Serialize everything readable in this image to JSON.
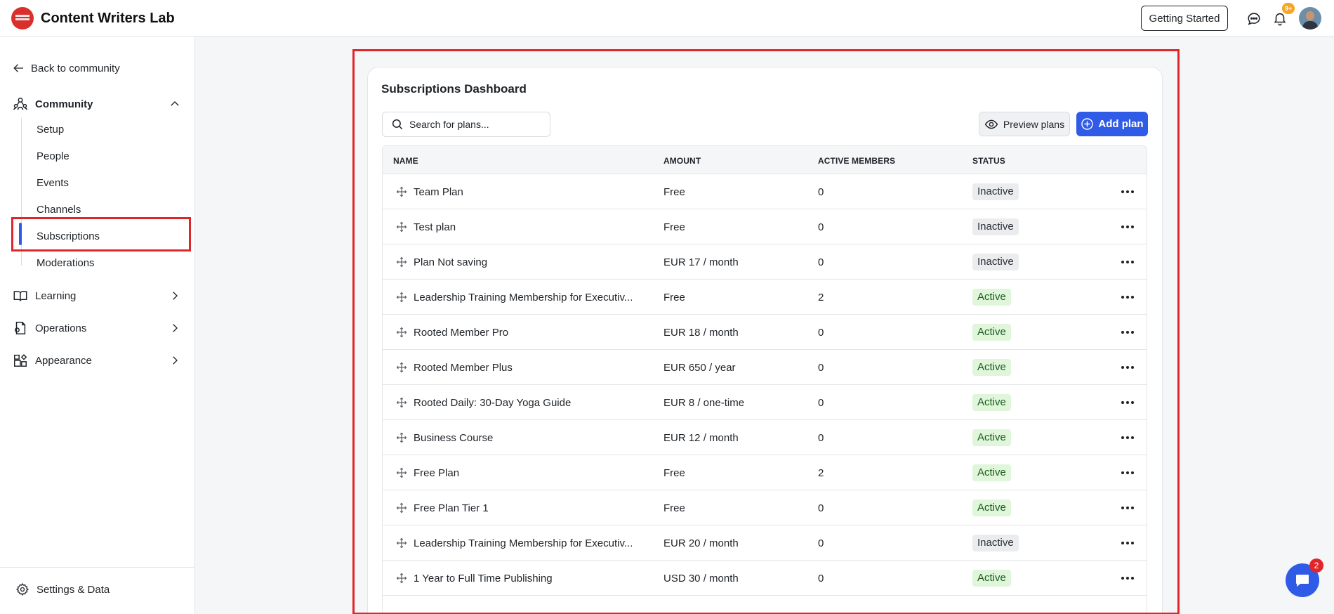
{
  "header": {
    "brand": "Content Writers Lab",
    "getting_started": "Getting Started",
    "notifications_count": "9+"
  },
  "sidebar": {
    "back_label": "Back to community",
    "community_label": "Community",
    "community_items": [
      "Setup",
      "People",
      "Events",
      "Channels",
      "Subscriptions",
      "Moderations"
    ],
    "active_item": "Subscriptions",
    "learning_label": "Learning",
    "operations_label": "Operations",
    "appearance_label": "Appearance",
    "settings_label": "Settings & Data"
  },
  "dashboard": {
    "title": "Subscriptions Dashboard",
    "search_placeholder": "Search for plans...",
    "preview_label": "Preview plans",
    "add_label": "Add plan",
    "columns": [
      "NAME",
      "AMOUNT",
      "ACTIVE MEMBERS",
      "STATUS"
    ],
    "rows": [
      {
        "name": "Team Plan",
        "amount": "Free",
        "members": "0",
        "status": "Inactive"
      },
      {
        "name": "Test plan",
        "amount": "Free",
        "members": "0",
        "status": "Inactive"
      },
      {
        "name": "Plan Not saving",
        "amount": "EUR 17 / month",
        "members": "0",
        "status": "Inactive"
      },
      {
        "name": "Leadership Training Membership for Executiv...",
        "amount": "Free",
        "members": "2",
        "status": "Active"
      },
      {
        "name": "Rooted Member Pro",
        "amount": "EUR 18 / month",
        "members": "0",
        "status": "Active"
      },
      {
        "name": "Rooted Member Plus",
        "amount": "EUR 650 / year",
        "members": "0",
        "status": "Active"
      },
      {
        "name": "Rooted Daily: 30-Day Yoga Guide",
        "amount": "EUR 8 / one-time",
        "members": "0",
        "status": "Active"
      },
      {
        "name": "Business Course",
        "amount": "EUR 12 / month",
        "members": "0",
        "status": "Active"
      },
      {
        "name": "Free Plan",
        "amount": "Free",
        "members": "2",
        "status": "Active"
      },
      {
        "name": "Free Plan Tier 1",
        "amount": "Free",
        "members": "0",
        "status": "Active"
      },
      {
        "name": "Leadership Training Membership for Executiv...",
        "amount": "EUR 20 / month",
        "members": "0",
        "status": "Inactive"
      },
      {
        "name": "1 Year to Full Time Publishing",
        "amount": "USD 30 / month",
        "members": "0",
        "status": "Active"
      }
    ]
  },
  "help": {
    "unread_count": "2"
  },
  "colors": {
    "accent": "#2f5be7",
    "highlight_outline": "#e0262b",
    "active_badge_bg": "#dff6da",
    "inactive_badge_bg": "#ebecee"
  }
}
